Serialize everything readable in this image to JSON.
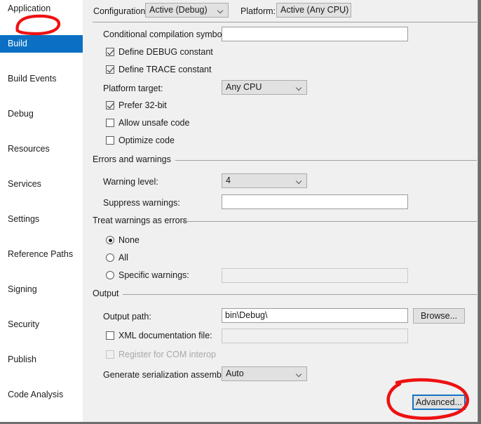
{
  "sidebar": {
    "items": [
      {
        "label": "Application",
        "selected": false
      },
      {
        "label": "Build",
        "selected": true
      },
      {
        "label": "Build Events",
        "selected": false
      },
      {
        "label": "Debug",
        "selected": false
      },
      {
        "label": "Resources",
        "selected": false
      },
      {
        "label": "Services",
        "selected": false
      },
      {
        "label": "Settings",
        "selected": false
      },
      {
        "label": "Reference Paths",
        "selected": false
      },
      {
        "label": "Signing",
        "selected": false
      },
      {
        "label": "Security",
        "selected": false
      },
      {
        "label": "Publish",
        "selected": false
      },
      {
        "label": "Code Analysis",
        "selected": false
      }
    ]
  },
  "header": {
    "configuration_label": "Configuration:",
    "configuration_value": "Active (Debug)",
    "platform_label": "Platform:",
    "platform_value": "Active (Any CPU)"
  },
  "general": {
    "conditional_symbols_label": "Conditional compilation symbols:",
    "conditional_symbols_value": "",
    "define_debug_label": "Define DEBUG constant",
    "define_trace_label": "Define TRACE constant",
    "platform_target_label": "Platform target:",
    "platform_target_value": "Any CPU",
    "prefer32_label": "Prefer 32-bit",
    "allow_unsafe_label": "Allow unsafe code",
    "optimize_label": "Optimize code"
  },
  "errors_and_warnings": {
    "group_label": "Errors and warnings",
    "warning_level_label": "Warning level:",
    "warning_level_value": "4",
    "suppress_warnings_label": "Suppress warnings:",
    "suppress_warnings_value": ""
  },
  "treat_warnings": {
    "group_label": "Treat warnings as errors",
    "none_label": "None",
    "all_label": "All",
    "specific_label": "Specific warnings:",
    "specific_value": ""
  },
  "output": {
    "group_label": "Output",
    "output_path_label": "Output path:",
    "output_path_value": "bin\\Debug\\",
    "browse_label": "Browse...",
    "xml_doc_label": "XML documentation file:",
    "xml_doc_value": "",
    "com_interop_label": "Register for COM interop",
    "serialization_label": "Generate serialization assembly:",
    "serialization_value": "Auto",
    "advanced_label": "Advanced..."
  },
  "colors": {
    "selection_blue": "#0b70c4",
    "annotation_red": "#ee1111",
    "focus_blue": "#1573c4",
    "pane_background": "#f0f0f0"
  }
}
